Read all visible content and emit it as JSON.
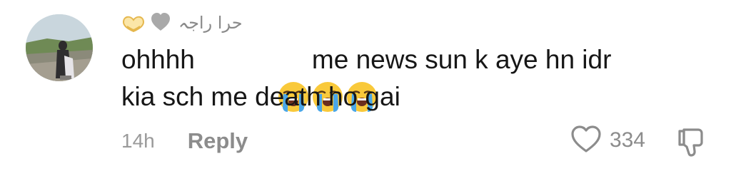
{
  "comment": {
    "username": "حرا راجہ",
    "username_emoji_icons": [
      "heart-hands-icon",
      "grey-heart-icon"
    ],
    "text_line1_before": "ohhhh",
    "text_emoji_icons": [
      "loudly-crying-face-icon",
      "loudly-crying-face-icon",
      "loudly-crying-face-icon"
    ],
    "text_line1_after": "me news sun k aye hn idr",
    "text_line2": "kia sch me death ho gai",
    "time": "14h",
    "reply_label": "Reply",
    "like_count": "334"
  },
  "colors": {
    "text": "#161616",
    "muted": "#8c8c8c",
    "background": "#ffffff"
  }
}
